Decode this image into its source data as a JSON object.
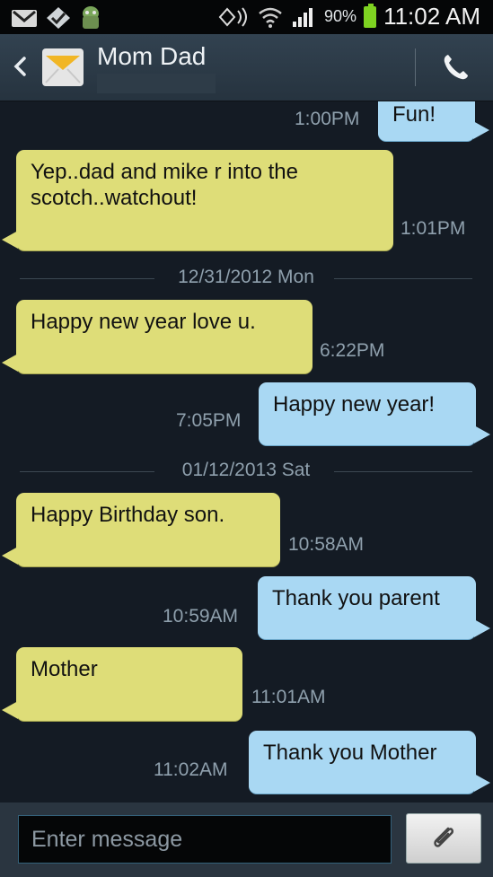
{
  "status_bar": {
    "battery_percent": "90%",
    "time": "11:02 AM",
    "icons": [
      "gmail-icon",
      "check-app-icon",
      "android-icon",
      "nfc-icon",
      "wifi-icon",
      "signal-icon",
      "battery-icon"
    ]
  },
  "header": {
    "contact_name": "Mom Dad",
    "back_icon": "chevron-left-icon",
    "avatar_icon": "envelope-icon",
    "call_icon": "phone-icon"
  },
  "messages": [
    {
      "dir": "out",
      "text": "Fun!",
      "time": "1:00PM"
    },
    {
      "dir": "in",
      "text": "Yep..dad and mike r into the scotch..watchout!",
      "time": "1:01PM"
    },
    {
      "type": "date",
      "text": "12/31/2012 Mon"
    },
    {
      "dir": "in",
      "text": "Happy new year love u.",
      "time": "6:22PM"
    },
    {
      "dir": "out",
      "text": "Happy new year!",
      "time": "7:05PM"
    },
    {
      "type": "date",
      "text": "01/12/2013 Sat"
    },
    {
      "dir": "in",
      "text": "Happy Birthday son.",
      "time": "10:58AM"
    },
    {
      "dir": "out",
      "text": "Thank you parent",
      "time": "10:59AM"
    },
    {
      "dir": "in",
      "text": "Mother",
      "time": "11:01AM"
    },
    {
      "dir": "out",
      "text": "Thank you Mother",
      "time": "11:02AM"
    }
  ],
  "composer": {
    "placeholder": "Enter message",
    "attach_icon": "paperclip-icon"
  },
  "colors": {
    "incoming_bubble": "#dedd78",
    "outgoing_bubble": "#a9d8f3",
    "background": "#141b24"
  }
}
